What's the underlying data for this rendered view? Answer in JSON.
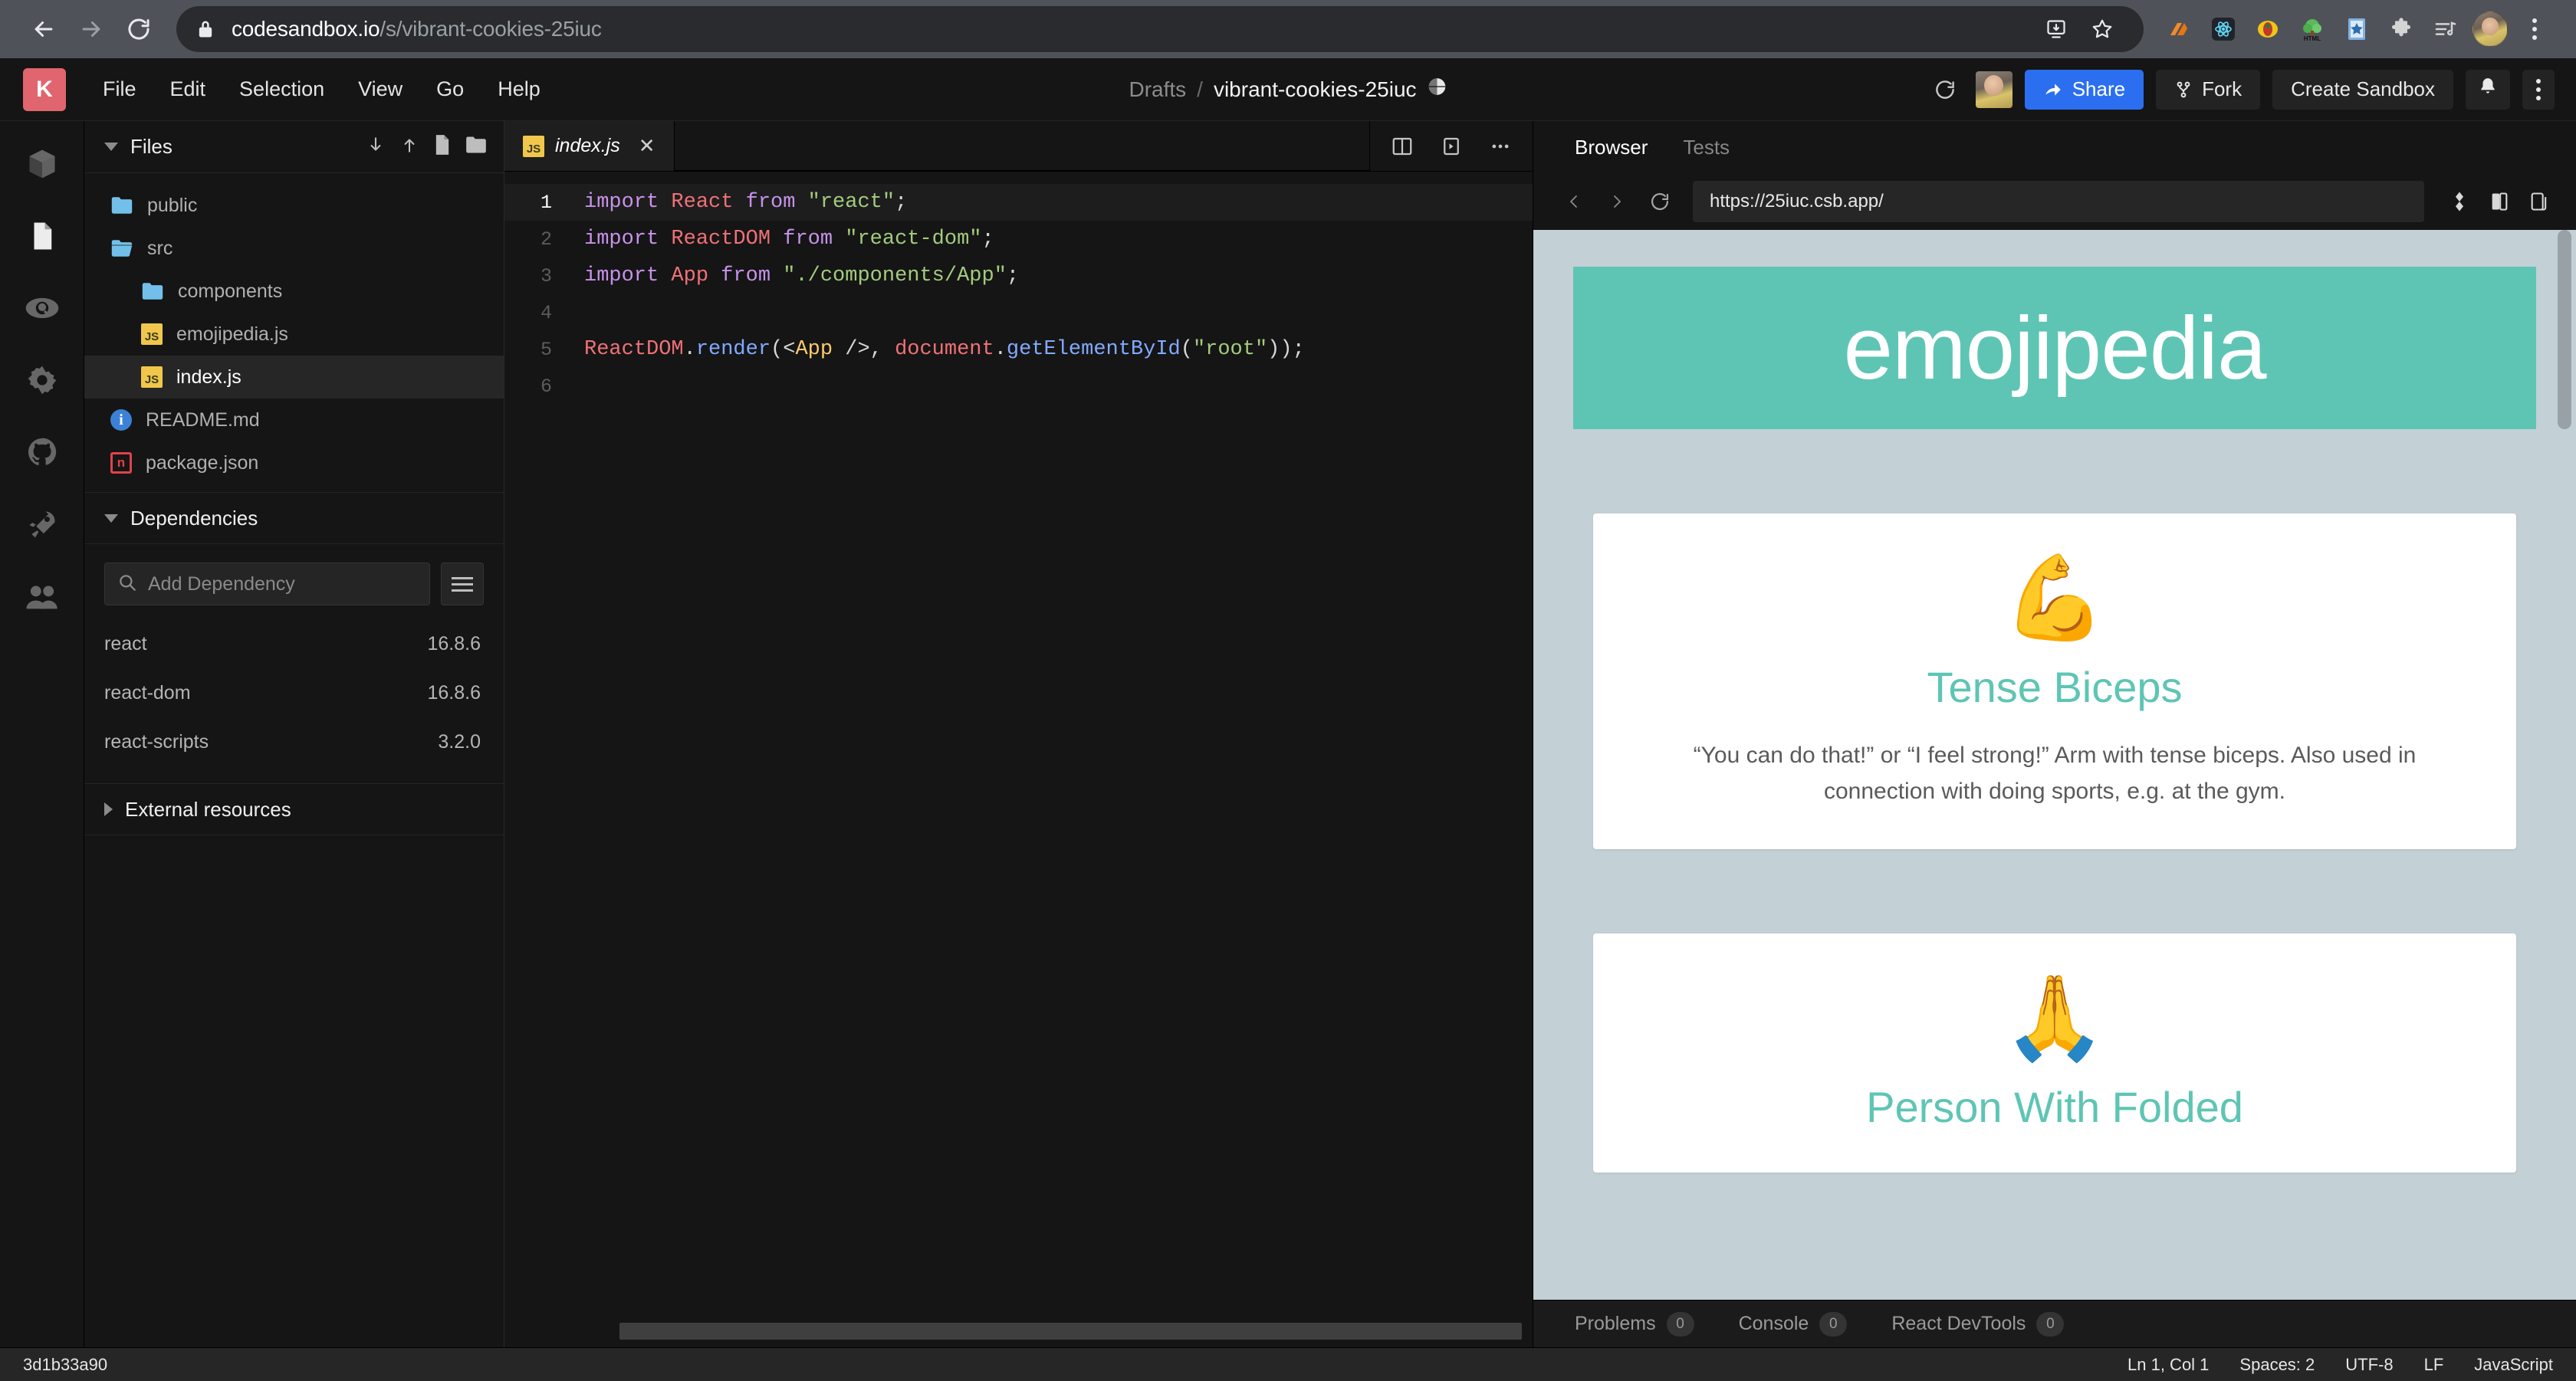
{
  "browser": {
    "back_icon": "arrow-left-icon",
    "forward_icon": "arrow-right-icon",
    "reload_icon": "reload-icon",
    "lock_icon": "lock-icon",
    "url_domain": "codesandbox.io",
    "url_path": "/s/vibrant-cookies-25iuc",
    "install_icon": "install-app-icon",
    "bookmark_icon": "star-icon",
    "extensions": [
      {
        "name": "drive-extension-icon",
        "glyph": "◢"
      },
      {
        "name": "react-devtools-extension-icon",
        "glyph": "⚛"
      },
      {
        "name": "bug-extension-icon",
        "glyph": "🐞"
      },
      {
        "name": "html-tree-extension-icon",
        "glyph": "🌳"
      },
      {
        "name": "pocket-extension-icon",
        "glyph": "★"
      },
      {
        "name": "puzzle-extensions-icon",
        "glyph": "🧩"
      },
      {
        "name": "music-queue-extension-icon",
        "glyph": "☰"
      }
    ],
    "profile_name": "profile-avatar",
    "menu_icon": "chrome-menu-kebab-icon"
  },
  "csb_header": {
    "logo_letter": "K",
    "menus": [
      "File",
      "Edit",
      "Selection",
      "View",
      "Go",
      "Help"
    ],
    "breadcrumb_parent": "Drafts",
    "breadcrumb_sep": "/",
    "sandbox_name": "vibrant-cookies-25iuc",
    "globe_icon": "globe-icon",
    "refresh_icon": "refresh-icon",
    "share_label": "Share",
    "fork_label": "Fork",
    "create_label": "Create Sandbox",
    "bell_icon": "bell-icon",
    "more_icon": "more-vertical-icon",
    "share_color": "#2b6ff0"
  },
  "rail": {
    "items": [
      {
        "name": "sidebar-item-explorer-package",
        "icon": "package-box-icon",
        "active": false
      },
      {
        "name": "sidebar-item-files",
        "icon": "file-document-icon",
        "active": true
      },
      {
        "name": "sidebar-item-search",
        "icon": "search-icon",
        "active": false
      },
      {
        "name": "sidebar-item-settings",
        "icon": "gear-icon",
        "active": false
      },
      {
        "name": "sidebar-item-github",
        "icon": "github-icon",
        "active": false
      },
      {
        "name": "sidebar-item-deploy",
        "icon": "rocket-icon",
        "active": false
      },
      {
        "name": "sidebar-item-live",
        "icon": "people-icon",
        "active": false
      }
    ]
  },
  "files_panel": {
    "title": "Files",
    "actions": [
      "download-icon",
      "upload-icon",
      "new-file-icon",
      "new-folder-icon"
    ],
    "tree": [
      {
        "label": "public",
        "kind": "folder",
        "depth": 0,
        "selected": false,
        "open": false
      },
      {
        "label": "src",
        "kind": "folder-open",
        "depth": 0,
        "selected": false,
        "open": true
      },
      {
        "label": "components",
        "kind": "folder",
        "depth": 1,
        "selected": false,
        "open": false
      },
      {
        "label": "emojipedia.js",
        "kind": "js",
        "depth": 1,
        "selected": false,
        "open": false
      },
      {
        "label": "index.js",
        "kind": "js",
        "depth": 1,
        "selected": true,
        "open": false
      },
      {
        "label": "README.md",
        "kind": "md",
        "depth": 0,
        "selected": false,
        "open": false
      },
      {
        "label": "package.json",
        "kind": "json",
        "depth": 0,
        "selected": false,
        "open": false
      }
    ]
  },
  "dependencies_panel": {
    "title": "Dependencies",
    "search_placeholder": "Add Dependency",
    "search_icon": "search-icon",
    "menu_icon": "hamburger-icon",
    "items": [
      {
        "name": "react",
        "version": "16.8.6"
      },
      {
        "name": "react-dom",
        "version": "16.8.6"
      },
      {
        "name": "react-scripts",
        "version": "3.2.0"
      }
    ]
  },
  "external_resources": {
    "title": "External resources"
  },
  "editor": {
    "tab_label": "index.js",
    "tab_icon": "js-file-icon",
    "close_icon": "close-icon",
    "actions": [
      "split-pane-icon",
      "preview-pane-icon",
      "more-horizontal-icon"
    ],
    "lines": [
      {
        "num": "1",
        "active": true,
        "tokens": [
          {
            "t": "kw",
            "v": "import"
          },
          {
            "t": "pun",
            "v": " "
          },
          {
            "t": "id",
            "v": "React"
          },
          {
            "t": "pun",
            "v": " "
          },
          {
            "t": "kw",
            "v": "from"
          },
          {
            "t": "pun",
            "v": " "
          },
          {
            "t": "str",
            "v": "\"react\""
          },
          {
            "t": "pun",
            "v": ";"
          }
        ]
      },
      {
        "num": "2",
        "active": false,
        "tokens": [
          {
            "t": "kw",
            "v": "import"
          },
          {
            "t": "pun",
            "v": " "
          },
          {
            "t": "id",
            "v": "ReactDOM"
          },
          {
            "t": "pun",
            "v": " "
          },
          {
            "t": "kw",
            "v": "from"
          },
          {
            "t": "pun",
            "v": " "
          },
          {
            "t": "str",
            "v": "\"react-dom\""
          },
          {
            "t": "pun",
            "v": ";"
          }
        ]
      },
      {
        "num": "3",
        "active": false,
        "tokens": [
          {
            "t": "kw",
            "v": "import"
          },
          {
            "t": "pun",
            "v": " "
          },
          {
            "t": "id",
            "v": "App"
          },
          {
            "t": "pun",
            "v": " "
          },
          {
            "t": "kw",
            "v": "from"
          },
          {
            "t": "pun",
            "v": " "
          },
          {
            "t": "str",
            "v": "\"./components/App\""
          },
          {
            "t": "pun",
            "v": ";"
          }
        ]
      },
      {
        "num": "4",
        "active": false,
        "tokens": []
      },
      {
        "num": "5",
        "active": false,
        "tokens": [
          {
            "t": "id",
            "v": "ReactDOM"
          },
          {
            "t": "pun",
            "v": "."
          },
          {
            "t": "fn",
            "v": "render"
          },
          {
            "t": "pun",
            "v": "("
          },
          {
            "t": "pun",
            "v": "<"
          },
          {
            "t": "tag",
            "v": "App"
          },
          {
            "t": "pun",
            "v": " />, "
          },
          {
            "t": "id",
            "v": "document"
          },
          {
            "t": "pun",
            "v": "."
          },
          {
            "t": "fn",
            "v": "getElementById"
          },
          {
            "t": "pun",
            "v": "("
          },
          {
            "t": "str",
            "v": "\"root\""
          },
          {
            "t": "pun",
            "v": "));"
          }
        ]
      },
      {
        "num": "6",
        "active": false,
        "tokens": []
      }
    ]
  },
  "preview": {
    "tabs": [
      {
        "label": "Browser",
        "active": true
      },
      {
        "label": "Tests",
        "active": false
      }
    ],
    "back_icon": "chevron-left-icon",
    "forward_icon": "chevron-right-icon",
    "reload_icon": "reload-icon",
    "url": "https://25iuc.csb.app/",
    "actions": [
      "responsive-icon",
      "open-new-window-icon",
      "external-link-icon"
    ],
    "app": {
      "header_title": "emojipedia",
      "header_bg": "#5ec5b4",
      "page_bg": "#c3d0d5",
      "cards": [
        {
          "emoji": "💪",
          "emoji_name": "flexed-biceps-emoji",
          "name": "Tense Biceps",
          "description": "“You can do that!” or “I feel strong!” Arm with tense biceps. Also used in connection with doing sports, e.g. at the gym."
        },
        {
          "emoji": "🙏",
          "emoji_name": "folded-hands-emoji",
          "name": "Person With Folded",
          "description": ""
        }
      ]
    },
    "statusbar": [
      {
        "label": "Problems",
        "count": "0"
      },
      {
        "label": "Console",
        "count": "0"
      },
      {
        "label": "React DevTools",
        "count": "0"
      }
    ]
  },
  "statusbar": {
    "commit_hash": "3d1b33a90",
    "cursor": "Ln 1, Col 1",
    "indent": "Spaces: 2",
    "encoding": "UTF-8",
    "eol": "LF",
    "language": "JavaScript"
  }
}
